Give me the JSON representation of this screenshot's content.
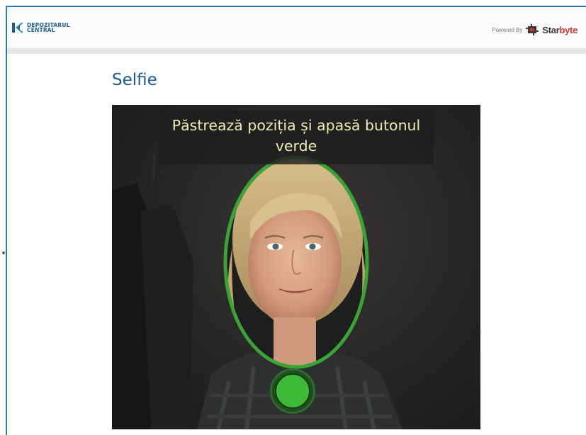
{
  "header": {
    "logo_text": "DEPOZITARUL\nCENTRAL",
    "powered_label": "Powered By",
    "brand_main": "Star",
    "brand_accent": "byte"
  },
  "page": {
    "title": "Selfie"
  },
  "camera": {
    "instruction": "Păstrează poziția și apasă butonul verde"
  },
  "colors": {
    "frame_border": "#2b7bb9",
    "title": "#1e5a8e",
    "face_guide": "#3aa335",
    "capture_button": "#3dba38"
  },
  "icons": {
    "logo": "dc-logo-icon",
    "starbyte": "starbyte-icon",
    "capture": "capture-button"
  }
}
